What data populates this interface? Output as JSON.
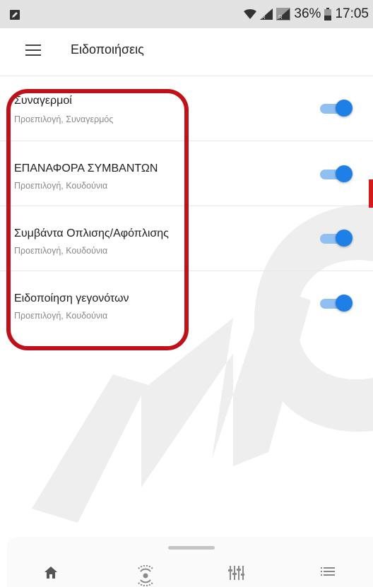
{
  "status_bar": {
    "battery_text": "36%",
    "time": "17:05",
    "icons": [
      "edit-square-icon",
      "wifi-icon",
      "signal-icon",
      "signal-icon",
      "battery-icon"
    ]
  },
  "app_bar": {
    "menu_icon": "hamburger-icon",
    "title": "Ειδοποιήσεις"
  },
  "notifications": [
    {
      "title": "Συναγερμοί",
      "subtitle": "Προεπιλογή, Συναγερμός",
      "enabled": true
    },
    {
      "title": "ΕΠΑΝΑΦΟΡΑ ΣΥΜΒΑΝΤΩΝ",
      "subtitle": "Προεπιλογή, Κουδούνια",
      "enabled": true
    },
    {
      "title": "Συμβάντα Οπλισης/Αφόπλισης",
      "subtitle": "Προεπιλογή, Κουδούνια",
      "enabled": true
    },
    {
      "title": "Ειδοποίηση γεγονότων",
      "subtitle": "Προεπιλογή, Κουδούνια",
      "enabled": true
    }
  ],
  "bottom_nav": {
    "items": [
      "home-icon",
      "sensor-icon",
      "controls-icon",
      "list-icon"
    ]
  },
  "colors": {
    "toggle_thumb": "#1e7fe6",
    "toggle_track": "#90bff2",
    "highlight": "#c0101a"
  },
  "watermark": "NC SECU"
}
